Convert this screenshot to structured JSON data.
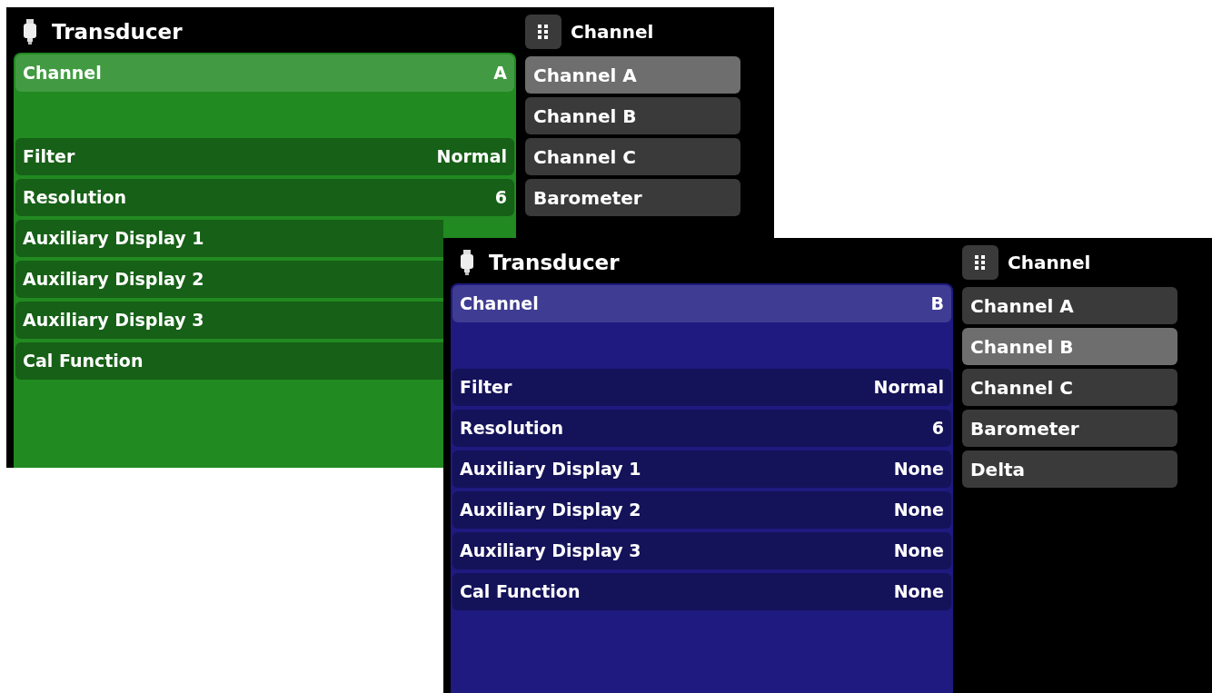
{
  "screens": [
    {
      "title": "Transducer",
      "color": "#218a21",
      "menu_title": "Channel",
      "rows": [
        {
          "label": "Channel",
          "value": "A",
          "selected": true
        },
        {
          "label": "Filter",
          "value": "Normal",
          "selected": false
        },
        {
          "label": "Resolution",
          "value": "6",
          "selected": false
        },
        {
          "label": "Auxiliary Display 1",
          "selected": false
        },
        {
          "label": "Auxiliary Display 2",
          "selected": false
        },
        {
          "label": "Auxiliary Display 3",
          "selected": false
        },
        {
          "label": "Cal Function",
          "selected": false
        }
      ],
      "options": [
        {
          "label": "Channel A",
          "selected": true
        },
        {
          "label": "Channel B",
          "selected": false
        },
        {
          "label": "Channel C",
          "selected": false
        },
        {
          "label": "Barometer",
          "selected": false
        }
      ]
    },
    {
      "title": "Transducer",
      "color": "#1e1a80",
      "menu_title": "Channel",
      "rows": [
        {
          "label": "Channel",
          "value": "B",
          "selected": true
        },
        {
          "label": "Filter",
          "value": "Normal",
          "selected": false
        },
        {
          "label": "Resolution",
          "value": "6",
          "selected": false
        },
        {
          "label": "Auxiliary Display 1",
          "value": "None",
          "selected": false
        },
        {
          "label": "Auxiliary Display 2",
          "value": "None",
          "selected": false
        },
        {
          "label": "Auxiliary Display 3",
          "value": "None",
          "selected": false
        },
        {
          "label": "Cal Function",
          "value": "None",
          "selected": false
        }
      ],
      "options": [
        {
          "label": "Channel A",
          "selected": false
        },
        {
          "label": "Channel B",
          "selected": true
        },
        {
          "label": "Channel C",
          "selected": false
        },
        {
          "label": "Barometer",
          "selected": false
        },
        {
          "label": "Delta",
          "selected": false
        }
      ]
    }
  ]
}
